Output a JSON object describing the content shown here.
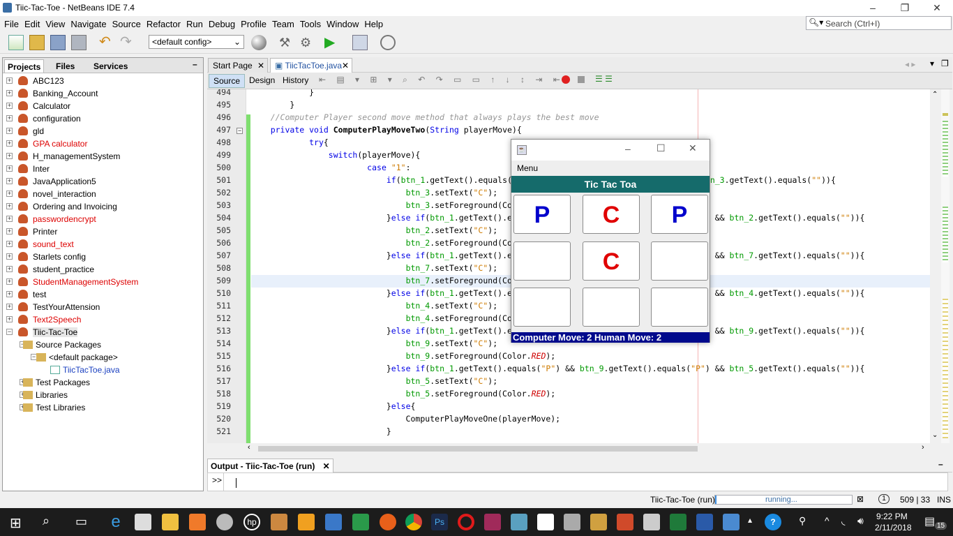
{
  "window": {
    "title": "Tiic-Tac-Toe - NetBeans IDE 7.4"
  },
  "menubar": [
    "File",
    "Edit",
    "View",
    "Navigate",
    "Source",
    "Refactor",
    "Run",
    "Debug",
    "Profile",
    "Team",
    "Tools",
    "Window",
    "Help"
  ],
  "search": {
    "placeholder": "Search (Ctrl+I)"
  },
  "toolbar": {
    "config": "<default config>"
  },
  "left_panel": {
    "tabs": [
      "Projects",
      "Files",
      "Services"
    ],
    "tree": [
      {
        "label": "ABC123",
        "red": false
      },
      {
        "label": "Banking_Account",
        "red": false
      },
      {
        "label": "Calculator",
        "red": false
      },
      {
        "label": "configuration",
        "red": false
      },
      {
        "label": "gld",
        "red": false
      },
      {
        "label": "GPA calculator",
        "red": true
      },
      {
        "label": "H_managementSystem",
        "red": false
      },
      {
        "label": "Inter",
        "red": false
      },
      {
        "label": "JavaApplication5",
        "red": false
      },
      {
        "label": "novel_interaction",
        "red": false
      },
      {
        "label": "Ordering and Invoicing",
        "red": false
      },
      {
        "label": "passwordencrypt",
        "red": true
      },
      {
        "label": "Printer",
        "red": false
      },
      {
        "label": "sound_text",
        "red": true
      },
      {
        "label": "Starlets config",
        "red": false
      },
      {
        "label": "student_practice",
        "red": false
      },
      {
        "label": "StudentManagementSystem",
        "red": true
      },
      {
        "label": "test",
        "red": false
      },
      {
        "label": "TestYourAttension",
        "red": false
      },
      {
        "label": "Text2Speech",
        "red": true
      },
      {
        "label": "Tiic-Tac-Toe",
        "red": false
      }
    ],
    "subtree": [
      "Source Packages",
      "<default package>",
      "TiicTacToe.java",
      "Test Packages",
      "Libraries",
      "Test Libraries"
    ]
  },
  "editor": {
    "tabs": [
      "Start Page",
      "TiicTacToe.java"
    ],
    "view_tabs": [
      "Source",
      "Design",
      "History"
    ],
    "lines": [
      {
        "n": "494",
        "code": "            }"
      },
      {
        "n": "495",
        "code": "        }"
      },
      {
        "n": "496",
        "code": "    //Computer Player second move method that always plays the best move"
      },
      {
        "n": "497",
        "code": "    private void ComputerPlayMoveTwo(String playerMove){"
      },
      {
        "n": "498",
        "code": "            try{"
      },
      {
        "n": "499",
        "code": "                switch(playerMove){"
      },
      {
        "n": "500",
        "code": "                        case \"1\":"
      },
      {
        "n": "501",
        "code": "                            if(btn_1.getText().equals(\"P\") && btn_2.getText().equals(\"P\") && btn_3.getText().equals(\"\")){"
      },
      {
        "n": "502",
        "code": "                                btn_3.setText(\"C\");"
      },
      {
        "n": "503",
        "code": "                                btn_3.setForeground(Color.RED);"
      },
      {
        "n": "504",
        "code": "                            }else if(btn_1.getText().equals(\"P\") && btn_3.getText().equals(\"P\") && btn_2.getText().equals(\"\")){"
      },
      {
        "n": "505",
        "code": "                                btn_2.setText(\"C\");"
      },
      {
        "n": "506",
        "code": "                                btn_2.setForeground(Color.RED);"
      },
      {
        "n": "507",
        "code": "                            }else if(btn_1.getText().equals(\"P\") && btn_4.getText().equals(\"P\") && btn_7.getText().equals(\"\")){"
      },
      {
        "n": "508",
        "code": "                                btn_7.setText(\"C\");"
      },
      {
        "n": "509",
        "code": "                                btn_7.setForeground(Color.RED);"
      },
      {
        "n": "510",
        "code": "                            }else if(btn_1.getText().equals(\"P\") && btn_7.getText().equals(\"P\") && btn_4.getText().equals(\"\")){"
      },
      {
        "n": "511",
        "code": "                                btn_4.setText(\"C\");"
      },
      {
        "n": "512",
        "code": "                                btn_4.setForeground(Color.RED);"
      },
      {
        "n": "513",
        "code": "                            }else if(btn_1.getText().equals(\"P\") && btn_5.getText().equals(\"P\") && btn_9.getText().equals(\"\")){"
      },
      {
        "n": "514",
        "code": "                                btn_9.setText(\"C\");"
      },
      {
        "n": "515",
        "code": "                                btn_9.setForeground(Color.RED);"
      },
      {
        "n": "516",
        "code": "                            }else if(btn_1.getText().equals(\"P\") && btn_9.getText().equals(\"P\") && btn_5.getText().equals(\"\")){"
      },
      {
        "n": "517",
        "code": "                                btn_5.setText(\"C\");"
      },
      {
        "n": "518",
        "code": "                                btn_5.setForeground(Color.RED);"
      },
      {
        "n": "519",
        "code": "                            }else{"
      },
      {
        "n": "520",
        "code": "                                ComputerPlayMoveOne(playerMove);"
      },
      {
        "n": "521",
        "code": "                            }"
      }
    ]
  },
  "output": {
    "title": "Output - Tiic-Tac-Toe (run)",
    "prompt": ">>"
  },
  "status": {
    "project": "Tiic-Tac-Toe (run)",
    "progress": "running...",
    "badge": "1",
    "position": "509 | 33",
    "mode": "INS"
  },
  "game": {
    "menu": "Menu",
    "title": "Tic Tac Toa",
    "cells": [
      "P",
      "C",
      "P",
      "",
      "C",
      "",
      "",
      "",
      ""
    ],
    "footer": "Computer Move:  2   Human Move:  2",
    "colors": {
      "P": "#0000cc",
      "C": "#e00000",
      "header": "#156b6b",
      "footer": "#000a8c"
    }
  },
  "taskbar": {
    "time": "9:22 PM",
    "date": "2/11/2018",
    "notifications": "15"
  }
}
